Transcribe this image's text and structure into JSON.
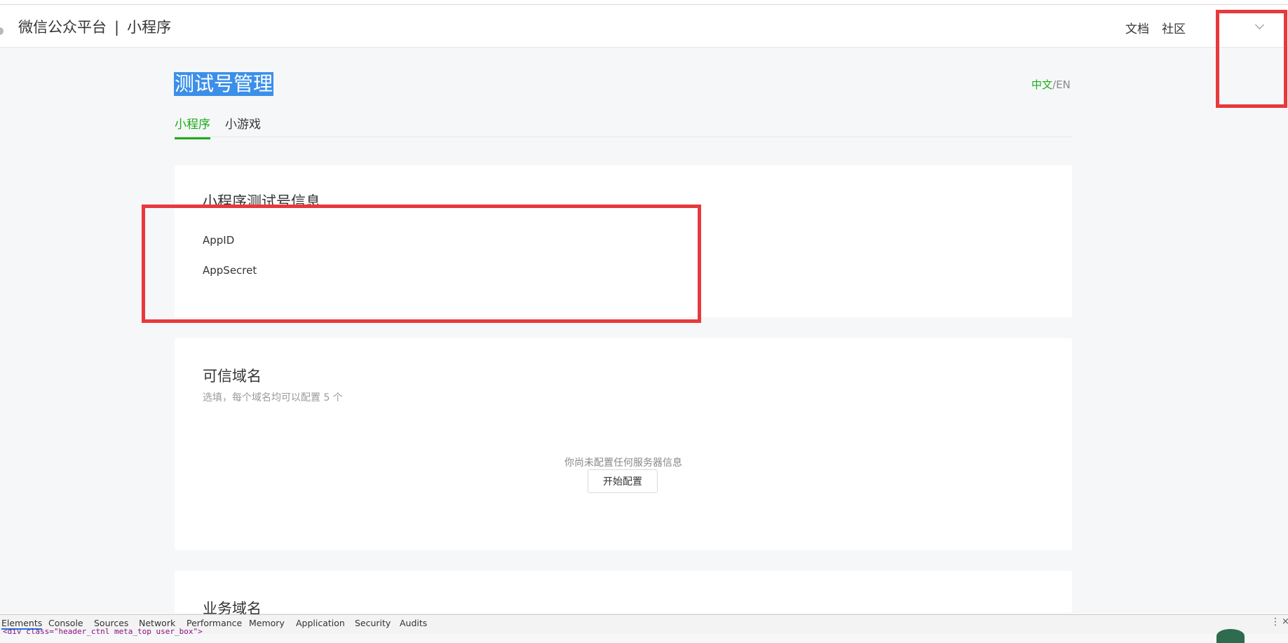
{
  "header": {
    "brand_name": "微信公众平台",
    "brand_separator": "|",
    "brand_sub": "小程序",
    "nav": {
      "docs": "文档",
      "community": "社区"
    }
  },
  "page": {
    "title": "测试号管理",
    "lang": {
      "zh": "中文",
      "slash": "/",
      "en": "EN"
    },
    "tabs": [
      "小程序",
      "小游戏"
    ]
  },
  "card_info": {
    "title": "小程序测试号信息",
    "fields": [
      "AppID",
      "AppSecret"
    ]
  },
  "card_domains": {
    "title": "可信域名",
    "hint": "选填，每个域名均可以配置 5 个",
    "empty_text": "你尚未配置任何服务器信息",
    "button": "开始配置"
  },
  "card_business": {
    "title": "业务域名"
  },
  "devtools": {
    "tabs": [
      "Elements",
      "Console",
      "Sources",
      "Network",
      "Performance",
      "Memory",
      "Application",
      "Security",
      "Audits"
    ],
    "code_line": "<div class=\"header_ctnl meta_top user_box\">",
    "menu": "⋮",
    "close": "×"
  },
  "colors": {
    "accent": "#1aad19",
    "annotation": "#e8393c",
    "selection": "#3b8fe9"
  }
}
